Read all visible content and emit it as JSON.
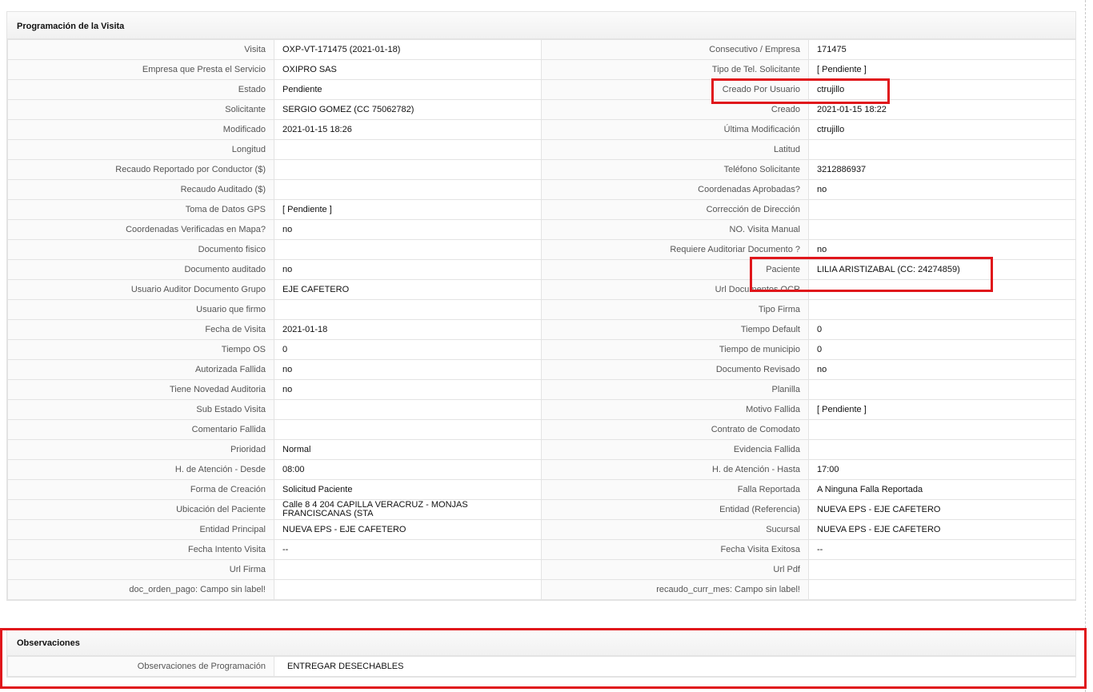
{
  "programacion": {
    "title": "Programación de la Visita",
    "rows": [
      {
        "l1": "Visita",
        "v1": "OXP-VT-171475 (2021-01-18)",
        "l2": "Consecutivo / Empresa",
        "v2": "171475"
      },
      {
        "l1": "Empresa que Presta el Servicio",
        "v1": "OXIPRO SAS",
        "l2": "Tipo de Tel. Solicitante",
        "v2": "[ Pendiente ]"
      },
      {
        "l1": "Estado",
        "v1": "Pendiente",
        "l2": "Creado Por Usuario",
        "v2": "ctrujillo"
      },
      {
        "l1": "Solicitante",
        "v1": "SERGIO GOMEZ (CC 75062782)",
        "l2": "Creado",
        "v2": "2021-01-15 18:22"
      },
      {
        "l1": "Modificado",
        "v1": "2021-01-15 18:26",
        "l2": "Última Modificación",
        "v2": " ctrujillo"
      },
      {
        "l1": "Longitud",
        "v1": "",
        "l2": "Latitud",
        "v2": ""
      },
      {
        "l1": "Recaudo Reportado por Conductor ($)",
        "v1": "",
        "l2": "Teléfono Solicitante",
        "v2": "3212886937"
      },
      {
        "l1": "Recaudo Auditado ($)",
        "v1": "",
        "l2": "Coordenadas Aprobadas?",
        "v2": " no"
      },
      {
        "l1": "Toma de Datos GPS",
        "v1": "[ Pendiente ]",
        "l2": "Corrección de Dirección",
        "v2": ""
      },
      {
        "l1": "Coordenadas Verificadas en Mapa?",
        "v1": " no",
        "l2": "NO. Visita Manual",
        "v2": ""
      },
      {
        "l1": "Documento fisico",
        "v1": "",
        "l2": "Requiere Auditoriar Documento ?",
        "v2": " no"
      },
      {
        "l1": "Documento auditado",
        "v1": " no",
        "l2": "Paciente",
        "v2": "LILIA ARISTIZABAL (CC: 24274859)"
      },
      {
        "l1": "Usuario Auditor Documento Grupo",
        "v1": "EJE CAFETERO",
        "l2": "Url Documentos OCR",
        "v2": ""
      },
      {
        "l1": "Usuario que firmo",
        "v1": "",
        "l2": "Tipo Firma",
        "v2": ""
      },
      {
        "l1": "Fecha de Visita",
        "v1": " 2021-01-18",
        "l2": "Tiempo Default",
        "v2": "0"
      },
      {
        "l1": "Tiempo OS",
        "v1": "0",
        "l2": "Tiempo de municipio",
        "v2": "0"
      },
      {
        "l1": "Autorizada Fallida",
        "v1": " no",
        "l2": "Documento Revisado",
        "v2": " no"
      },
      {
        "l1": "Tiene Novedad Auditoria",
        "v1": " no",
        "l2": "Planilla",
        "v2": ""
      },
      {
        "l1": "Sub Estado Visita",
        "v1": "",
        "l2": "Motivo Fallida",
        "v2": "[ Pendiente ]"
      },
      {
        "l1": "Comentario Fallida",
        "v1": "",
        "l2": "Contrato de Comodato",
        "v2": ""
      },
      {
        "l1": "Prioridad",
        "v1": "Normal",
        "l2": "Evidencia Fallida",
        "v2": ""
      },
      {
        "l1": "H. de Atención - Desde",
        "v1": "08:00",
        "l2": "H. de Atención - Hasta",
        "v2": "17:00"
      },
      {
        "l1": "Forma de Creación",
        "v1": "Solicitud Paciente",
        "l2": "Falla Reportada",
        "v2": "A Ninguna Falla Reportada"
      },
      {
        "l1": "Ubicación del Paciente",
        "v1": "Calle 8 4 204 CAPILLA VERACRUZ - MONJAS FRANCISCANAS (STA",
        "l2": "Entidad (Referencia)",
        "v2": "NUEVA EPS - EJE CAFETERO"
      },
      {
        "l1": "Entidad Principal",
        "v1": "NUEVA EPS - EJE CAFETERO",
        "l2": "Sucursal",
        "v2": "NUEVA EPS - EJE CAFETERO"
      },
      {
        "l1": "Fecha Intento Visita",
        "v1": " --",
        "l2": "Fecha Visita Exitosa",
        "v2": " --"
      },
      {
        "l1": "Url Firma",
        "v1": "",
        "l2": "Url Pdf",
        "v2": ""
      },
      {
        "l1": "doc_orden_pago: Campo sin label!",
        "v1": "",
        "l2": "recaudo_curr_mes: Campo sin label!",
        "v2": ""
      }
    ]
  },
  "observaciones": {
    "title": "Observaciones",
    "label": "Observaciones de Programación",
    "value": "ENTREGAR DESECHABLES"
  },
  "highlight_color": "#e0161b"
}
